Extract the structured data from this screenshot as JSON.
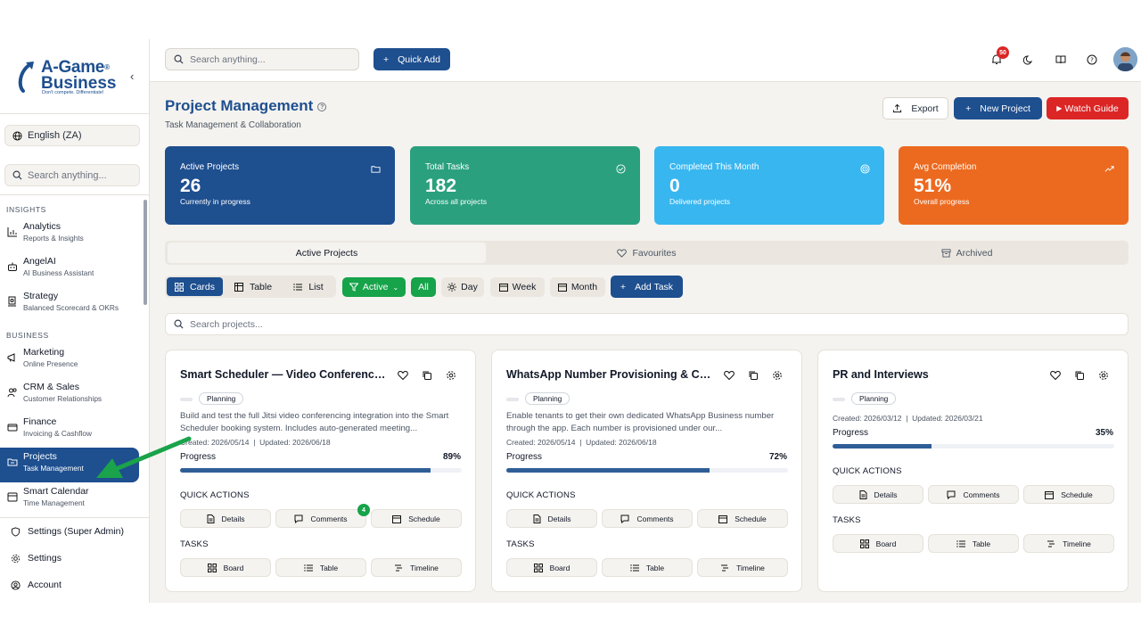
{
  "brand": {
    "line1": "A-Game",
    "line2": "Business",
    "reg": "®",
    "tagline": "Don't compete. Differentiate!"
  },
  "sidebar": {
    "language": "English (ZA)",
    "search_placeholder": "Search anything...",
    "sections": [
      {
        "title": "INSIGHTS",
        "items": [
          {
            "label": "Analytics",
            "sub": "Reports & Insights",
            "icon": "bar-chart-icon"
          },
          {
            "label": "AngelAI",
            "sub": "AI Business Assistant",
            "icon": "robot-icon"
          },
          {
            "label": "Strategy",
            "sub": "Balanced Scorecard & OKRs",
            "icon": "target-icon"
          }
        ]
      },
      {
        "title": "BUSINESS",
        "items": [
          {
            "label": "Marketing",
            "sub": "Online Presence",
            "icon": "megaphone-icon"
          },
          {
            "label": "CRM & Sales",
            "sub": "Customer Relationships",
            "icon": "users-icon"
          },
          {
            "label": "Finance",
            "sub": "Invoicing & Cashflow",
            "icon": "wallet-icon"
          },
          {
            "label": "Projects",
            "sub": "Task Management",
            "icon": "folder-icon",
            "active": true
          },
          {
            "label": "Smart Calendar",
            "sub": "Time Management",
            "icon": "calendar-icon"
          }
        ]
      }
    ],
    "bottom": [
      {
        "label": "Settings (Super Admin)",
        "icon": "shield-icon"
      },
      {
        "label": "Settings",
        "icon": "gear-icon"
      },
      {
        "label": "Account",
        "icon": "user-circle-icon"
      }
    ]
  },
  "topbar": {
    "search_placeholder": "Search anything...",
    "quick_add": "Quick Add",
    "notification_count": "50"
  },
  "page": {
    "title": "Project Management",
    "subtitle": "Task Management & Collaboration",
    "export": "Export",
    "new_project": "New Project",
    "watch_guide": "Watch Guide"
  },
  "stats": [
    {
      "label": "Active Projects",
      "value": "26",
      "desc": "Currently in progress",
      "color": "#1e4f8f",
      "icon": "folder-icon"
    },
    {
      "label": "Total Tasks",
      "value": "182",
      "desc": "Across all projects",
      "color": "#2aa07e",
      "icon": "check-circle-icon"
    },
    {
      "label": "Completed This Month",
      "value": "0",
      "desc": "Delivered projects",
      "color": "#38b6ef",
      "icon": "target-icon"
    },
    {
      "label": "Avg Completion",
      "value": "51%",
      "desc": "Overall progress",
      "color": "#ec6a1f",
      "icon": "trending-up-icon"
    }
  ],
  "tabs": {
    "active": "Active Projects",
    "favourites": "Favourites",
    "archived": "Archived"
  },
  "toolbar": {
    "cards": "Cards",
    "table": "Table",
    "list": "List",
    "filter": "Active",
    "all": "All",
    "day": "Day",
    "week": "Week",
    "month": "Month",
    "add_task": "Add Task"
  },
  "project_search_placeholder": "Search projects...",
  "card_labels": {
    "progress": "Progress",
    "quick_actions": "QUICK ACTIONS",
    "tasks": "TASKS",
    "details": "Details",
    "comments": "Comments",
    "schedule": "Schedule",
    "board": "Board",
    "table": "Table",
    "timeline": "Timeline"
  },
  "projects": [
    {
      "title": "Smart Scheduler — Video Conferencing",
      "stage": "Planning",
      "desc": "Build and test the full Jitsi video conferencing integration into the Smart Scheduler booking system. Includes auto-generated meeting...",
      "created": "Created: 2026/05/14",
      "updated": "Updated: 2026/06/18",
      "progress": 89,
      "progress_label": "89%",
      "comments": "4"
    },
    {
      "title": "WhatsApp Number Provisioning & Credentials",
      "stage": "Planning",
      "desc": "Enable tenants to get their own dedicated WhatsApp Business number through the app. Each number is provisioned under our...",
      "created": "Created: 2026/05/14",
      "updated": "Updated: 2026/06/18",
      "progress": 72,
      "progress_label": "72%",
      "comments": ""
    },
    {
      "title": "PR and Interviews",
      "stage": "Planning",
      "desc": "",
      "created": "Created: 2026/03/12",
      "updated": "Updated: 2026/03/21",
      "progress": 35,
      "progress_label": "35%",
      "comments": ""
    }
  ],
  "colors": {
    "primary": "#1e4f8f",
    "danger": "#dc2626",
    "success": "#16a34a",
    "annotation_arrow": "#1aa34a"
  }
}
